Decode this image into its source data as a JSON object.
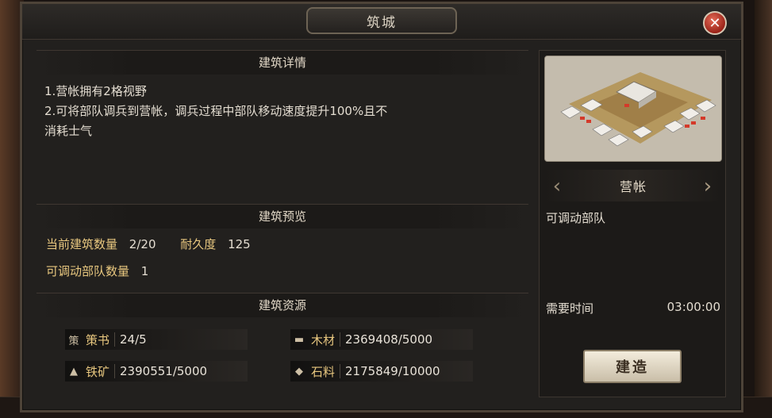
{
  "dialog": {
    "title": "筑城",
    "close_icon": "close-icon"
  },
  "details": {
    "header": "建筑详情",
    "lines": [
      "1.营帐拥有2格视野",
      "2.可将部队调兵到营帐，调兵过程中部队移动速度提升100%且不",
      "消耗士气"
    ]
  },
  "preview_section": {
    "header": "建筑预览",
    "count_label": "当前建筑数量",
    "count_value": "2/20",
    "durability_label": "耐久度",
    "durability_value": "125",
    "troops_label": "可调动部队数量",
    "troops_value": "1"
  },
  "resources": {
    "header": "建筑资源",
    "items": [
      {
        "icon": "strategy-book-icon",
        "icon_glyph": "策",
        "label": "策书",
        "value": "24/5"
      },
      {
        "icon": "wood-icon",
        "icon_glyph": "▬",
        "label": "木材",
        "value": "2369408/5000"
      },
      {
        "icon": "iron-icon",
        "icon_glyph": "▲",
        "label": "铁矿",
        "value": "2390551/5000"
      },
      {
        "icon": "stone-icon",
        "icon_glyph": "◆",
        "label": "石料",
        "value": "2175849/10000"
      }
    ]
  },
  "building": {
    "name": "营帐",
    "description": "可调动部队",
    "time_label": "需要时间",
    "time_value": "03:00:00",
    "build_button": "建造",
    "prev_icon": "chevron-left-icon",
    "next_icon": "chevron-right-icon"
  },
  "colors": {
    "accent_gold": "#e8c77f",
    "close_red": "#9b2419",
    "text": "#e4ddd1"
  }
}
